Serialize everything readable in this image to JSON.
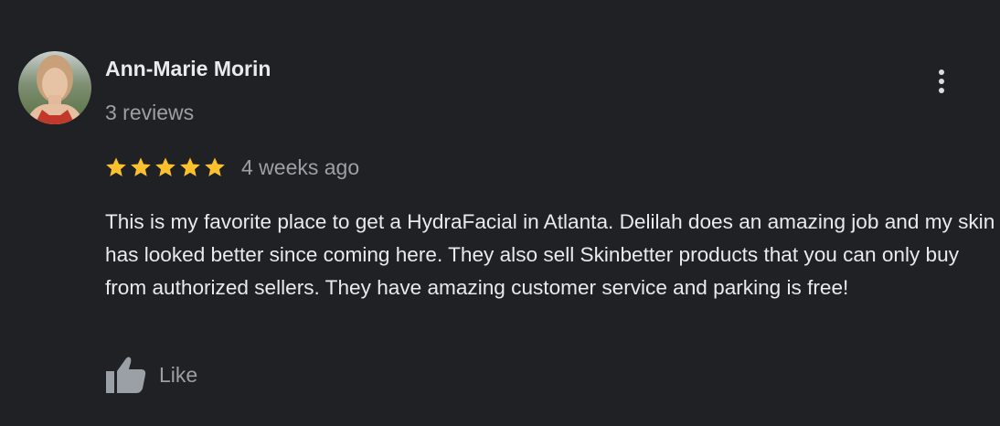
{
  "review": {
    "author_name": "Ann-Marie Morin",
    "author_reviews": "3 reviews",
    "rating": 5,
    "rating_max": 5,
    "time_ago": "4 weeks ago",
    "text": "This is my favorite place to get a HydraFacial in Atlanta. Delilah does an amazing job and my skin has looked better since coming here. They also sell Skinbetter products that you can only buy from authorized sellers. They have amazing customer service and parking is free!",
    "like_label": "Like"
  },
  "icons": {
    "avatar": "avatar-photo",
    "more": "more-vert-icon",
    "star": "star-icon",
    "like": "thumbs-up-icon"
  },
  "colors": {
    "background": "#202124",
    "name": "#e8eaed",
    "secondary_text": "#9aa0a6",
    "star": "#fbc02d"
  }
}
